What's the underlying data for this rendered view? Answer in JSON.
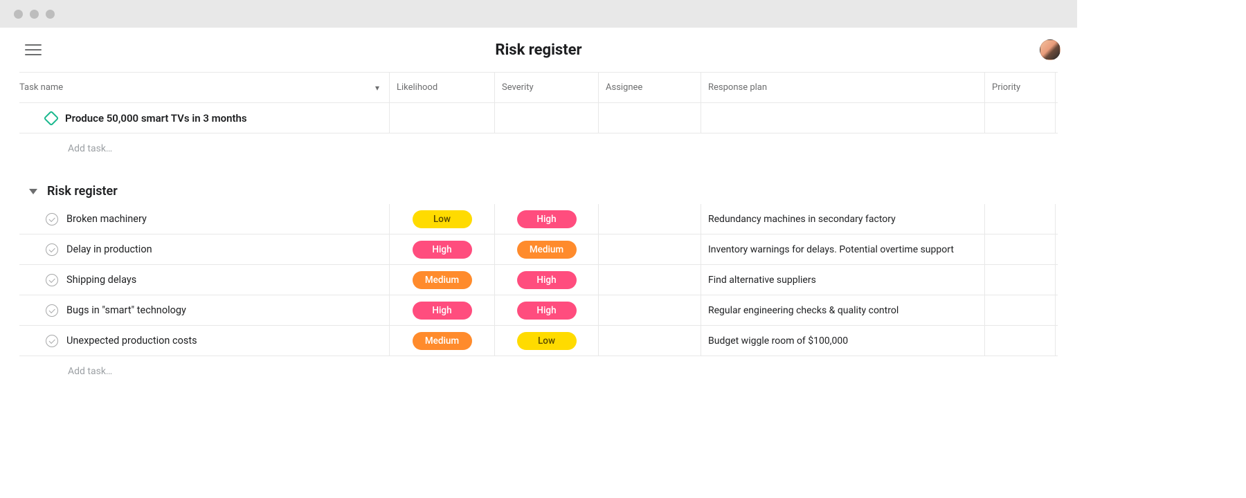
{
  "header": {
    "title": "Risk register"
  },
  "columns": {
    "task": "Task name",
    "likelihood": "Likelihood",
    "severity": "Severity",
    "assignee": "Assignee",
    "response": "Response plan",
    "priority": "Priority"
  },
  "goal": {
    "name": "Produce 50,000 smart TVs in 3 months"
  },
  "add_task_label": "Add task…",
  "section": {
    "title": "Risk register"
  },
  "tasks": [
    {
      "name": "Broken machinery",
      "likelihood": "Low",
      "likelihood_class": "pill-low-yellow",
      "severity": "High",
      "severity_class": "pill-high-pink",
      "response": "Redundancy machines in secondary factory"
    },
    {
      "name": "Delay in production",
      "likelihood": "High",
      "likelihood_class": "pill-high-pink",
      "severity": "Medium",
      "severity_class": "pill-medium-orange",
      "response": "Inventory warnings for delays. Potential overtime support"
    },
    {
      "name": "Shipping delays",
      "likelihood": "Medium",
      "likelihood_class": "pill-medium-orange",
      "severity": "High",
      "severity_class": "pill-high-pink",
      "response": "Find alternative suppliers"
    },
    {
      "name": "Bugs in \"smart\" technology",
      "likelihood": "High",
      "likelihood_class": "pill-high-pink",
      "severity": "High",
      "severity_class": "pill-high-pink",
      "response": "Regular engineering checks & quality control"
    },
    {
      "name": "Unexpected production costs",
      "likelihood": "Medium",
      "likelihood_class": "pill-medium-orange",
      "severity": "Low",
      "severity_class": "pill-low-yellow",
      "response": "Budget wiggle room of $100,000"
    }
  ]
}
